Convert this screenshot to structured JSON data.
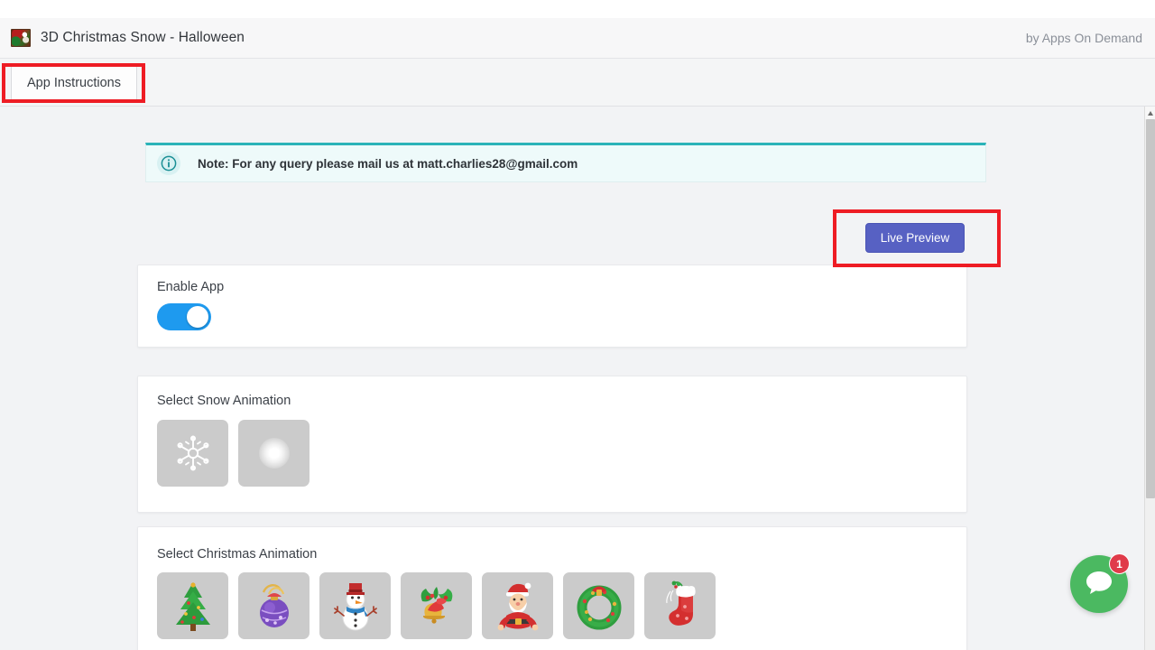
{
  "header": {
    "title": "3D Christmas Snow - Halloween",
    "author": "by Apps On Demand",
    "icon": "app-thumbnail-icon"
  },
  "tabs": [
    {
      "label": "App Instructions",
      "active": true,
      "highlighted": true
    }
  ],
  "note": {
    "icon": "info-circle-icon",
    "text": "Note: For any query please mail us at matt.charlies28@gmail.com",
    "accent_color": "#2bb3b8",
    "background_color": "#eefafa"
  },
  "toolbar": {
    "live_preview_label": "Live Preview",
    "live_preview_color": "#5761c3",
    "highlighted": true
  },
  "annotations": {
    "color": "#ee1c24",
    "boxes": [
      "tab-app-instructions",
      "live-preview-button"
    ]
  },
  "sections": {
    "enable": {
      "label": "Enable App",
      "toggle_state": "on",
      "toggle_color": "#1e9aef"
    },
    "snow": {
      "label": "Select Snow Animation",
      "tiles": [
        {
          "name": "snowflake",
          "icon": "snowflake-icon"
        },
        {
          "name": "soft-snow-dot",
          "icon": "blur-dot-icon"
        }
      ]
    },
    "christmas": {
      "label": "Select Christmas Animation",
      "tiles": [
        {
          "name": "christmas-tree",
          "icon": "christmas-tree-icon"
        },
        {
          "name": "ornament-ball",
          "icon": "ornament-ball-icon"
        },
        {
          "name": "snowman",
          "icon": "snowman-icon"
        },
        {
          "name": "holly-bells",
          "icon": "holly-bells-icon"
        },
        {
          "name": "santa-claus",
          "icon": "santa-claus-icon"
        },
        {
          "name": "wreath",
          "icon": "wreath-icon"
        },
        {
          "name": "stocking",
          "icon": "stocking-icon"
        }
      ]
    }
  },
  "chat": {
    "badge_count": "1",
    "icon": "chat-bubble-icon",
    "button_color": "#4bb961",
    "badge_color": "#e03b4a"
  },
  "scrollbar": {
    "up_arrow": "scroll-up-arrow-icon"
  }
}
